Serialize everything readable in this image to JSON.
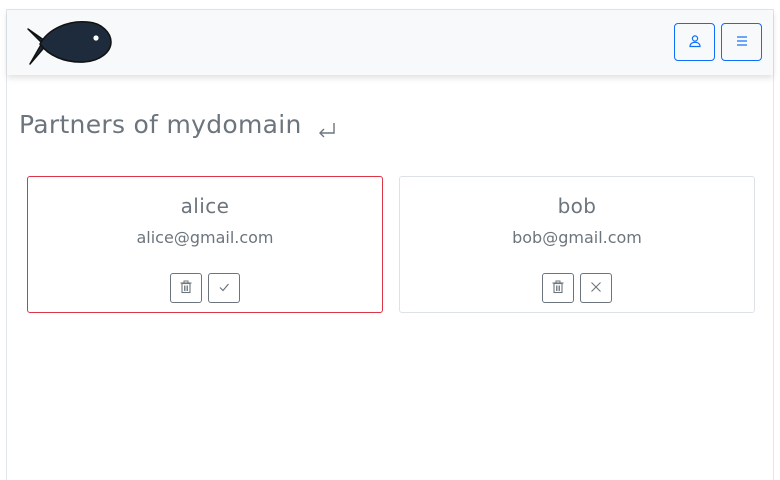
{
  "header": {
    "logo_icon": "fish-logo-icon",
    "user_button_icon": "user-icon",
    "menu_button_icon": "hamburger-menu-icon"
  },
  "page": {
    "title": "Partners of mydomain",
    "back_icon": "return-arrow-icon"
  },
  "partners": [
    {
      "name": "alice",
      "email": "alice@gmail.com",
      "selected": true,
      "actions": [
        "trash-icon",
        "check-icon"
      ]
    },
    {
      "name": "bob",
      "email": "bob@gmail.com",
      "selected": false,
      "actions": [
        "trash-icon",
        "close-icon"
      ]
    }
  ],
  "colors": {
    "primary": "#0d6efd",
    "danger": "#dc3545",
    "muted_text": "#6c757d",
    "navbar_bg": "#f8f9fa",
    "fish_fill": "#1e2b3c"
  }
}
